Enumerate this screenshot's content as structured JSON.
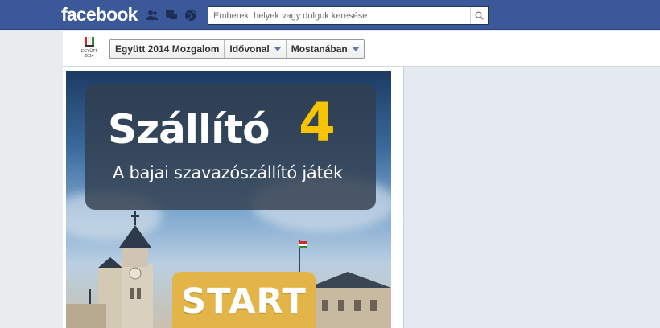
{
  "header": {
    "logo": "facebook",
    "search_placeholder": "Emberek, helyek vagy dolgok keresése",
    "icons": [
      "friends-icon",
      "messages-icon",
      "globe-icon",
      "search-icon"
    ],
    "brand_color": "#3b5998"
  },
  "page": {
    "thumb_caption_line1": "EGYÜTT",
    "thumb_caption_line2": "2014",
    "breadcrumbs": [
      {
        "label": "Együtt 2014 Mozgalom",
        "has_menu": false
      },
      {
        "label": "Idővonal",
        "has_menu": true
      },
      {
        "label": "Mostanában",
        "has_menu": true
      }
    ]
  },
  "game": {
    "title": "Szállító",
    "title_number": "4",
    "subtitle": "A bajai szavazószállító játék",
    "start_label": "START",
    "accent": "#f6c400",
    "button_color": "#e3b548"
  }
}
